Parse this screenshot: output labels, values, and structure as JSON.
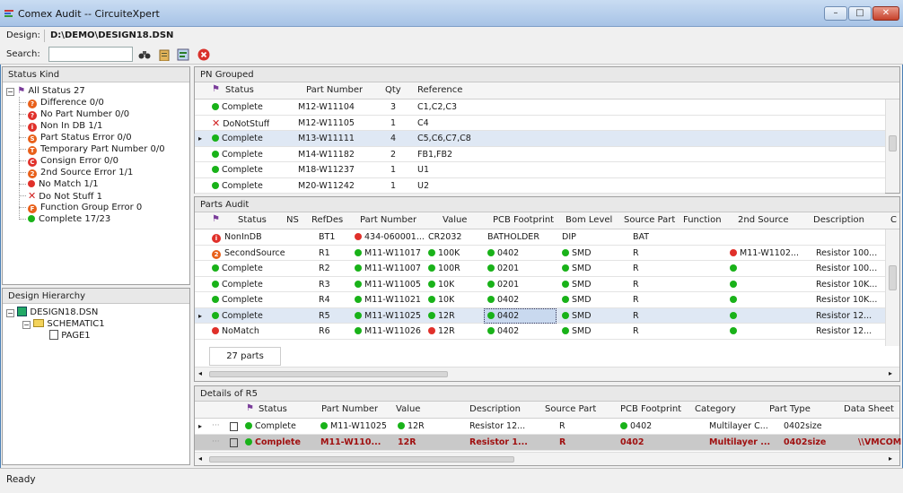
{
  "window": {
    "title": "Comex Audit -- CircuiteXpert",
    "min": "–",
    "max": "□",
    "close": "✕"
  },
  "design": {
    "label": "Design:",
    "path": "D:\\DEMO\\DESIGN18.DSN"
  },
  "search": {
    "label": "Search:",
    "value": ""
  },
  "status_kind": {
    "title": "Status Kind",
    "root": "All Status 27",
    "items": [
      {
        "label": "Difference 0/0",
        "icon": "o",
        "glyph": "?"
      },
      {
        "label": "No Part Number 0/0",
        "icon": "r",
        "glyph": "?"
      },
      {
        "label": "Non In DB 1/1",
        "icon": "r",
        "glyph": "i"
      },
      {
        "label": "Part Status Error 0/0",
        "icon": "o",
        "glyph": "S"
      },
      {
        "label": "Temporary Part Number 0/0",
        "icon": "o",
        "glyph": "T"
      },
      {
        "label": "Consign Error 0/0",
        "icon": "r",
        "glyph": "C"
      },
      {
        "label": "2nd Source Error 1/1",
        "icon": "o",
        "glyph": "2"
      },
      {
        "label": "No Match 1/1",
        "icon": "r",
        "glyph": ""
      },
      {
        "label": "Do Not Stuff 1",
        "icon": "x",
        "glyph": ""
      },
      {
        "label": "Function Group Error 0",
        "icon": "o",
        "glyph": "F"
      },
      {
        "label": "Complete 17/23",
        "icon": "g",
        "glyph": ""
      }
    ]
  },
  "hierarchy": {
    "title": "Design Hierarchy",
    "root": "DESIGN18.DSN",
    "schematic": "SCHEMATIC1",
    "page": "PAGE1"
  },
  "pn_grouped": {
    "title": "PN Grouped",
    "columns": [
      "Status",
      "Part Number",
      "Qty",
      "Reference"
    ],
    "rows": [
      {
        "status": "Complete",
        "pn": "M12-W11104",
        "qty": "3",
        "ref": "C1,C2,C3",
        "dot": "g"
      },
      {
        "status": "DoNotStuff",
        "pn": "M12-W11105",
        "qty": "1",
        "ref": "C4",
        "dot": "x"
      },
      {
        "status": "Complete",
        "pn": "M13-W11111",
        "qty": "4",
        "ref": "C5,C6,C7,C8",
        "dot": "g",
        "current": true
      },
      {
        "status": "Complete",
        "pn": "M14-W11182",
        "qty": "2",
        "ref": "FB1,FB2",
        "dot": "g"
      },
      {
        "status": "Complete",
        "pn": "M18-W11237",
        "qty": "1",
        "ref": "U1",
        "dot": "g"
      },
      {
        "status": "Complete",
        "pn": "M20-W11242",
        "qty": "1",
        "ref": "U2",
        "dot": "g"
      }
    ]
  },
  "parts_audit": {
    "title": "Parts Audit",
    "columns": [
      "Status",
      "NS",
      "RefDes",
      "Part Number",
      "Value",
      "PCB Footprint",
      "Bom Level",
      "Source Part",
      "Function",
      "2nd Source",
      "Description",
      "C"
    ],
    "rows": [
      {
        "status": "NonInDB",
        "ref": "BT1",
        "pn": "434-060001...",
        "val": "CR2032",
        "fp": "BATHOLDER",
        "bom": "DIP",
        "src": "BAT",
        "sec": "",
        "desc": "",
        "dot": "ri",
        "pndot": "r",
        "vdot": "",
        "fpdot": "",
        "bomdot": "",
        "secdot": ""
      },
      {
        "status": "SecondSource",
        "ref": "R1",
        "pn": "M11-W11017",
        "val": "100K",
        "fp": "0402",
        "bom": "SMD",
        "src": "R",
        "sec": "M11-W1102...",
        "desc": "Resistor 100...",
        "dot": "o2",
        "pndot": "g",
        "vdot": "g",
        "fpdot": "g",
        "bomdot": "g",
        "secdot": "r"
      },
      {
        "status": "Complete",
        "ref": "R2",
        "pn": "M11-W11007",
        "val": "100R",
        "fp": "0201",
        "bom": "SMD",
        "src": "R",
        "sec": "",
        "desc": "Resistor 100...",
        "dot": "g",
        "pndot": "g",
        "vdot": "g",
        "fpdot": "g",
        "bomdot": "g",
        "secdot": "g"
      },
      {
        "status": "Complete",
        "ref": "R3",
        "pn": "M11-W11005",
        "val": "10K",
        "fp": "0201",
        "bom": "SMD",
        "src": "R",
        "sec": "",
        "desc": "Resistor 10K...",
        "dot": "g",
        "pndot": "g",
        "vdot": "g",
        "fpdot": "g",
        "bomdot": "g",
        "secdot": "g"
      },
      {
        "status": "Complete",
        "ref": "R4",
        "pn": "M11-W11021",
        "val": "10K",
        "fp": "0402",
        "bom": "SMD",
        "src": "R",
        "sec": "",
        "desc": "Resistor 10K...",
        "dot": "g",
        "pndot": "g",
        "vdot": "g",
        "fpdot": "g",
        "bomdot": "g",
        "secdot": "g"
      },
      {
        "status": "Complete",
        "ref": "R5",
        "pn": "M11-W11025",
        "val": "12R",
        "fp": "0402",
        "bom": "SMD",
        "src": "R",
        "sec": "",
        "desc": "Resistor 12...",
        "dot": "g",
        "pndot": "g",
        "vdot": "g",
        "fpdot": "g",
        "bomdot": "g",
        "secdot": "g",
        "current": true
      },
      {
        "status": "NoMatch",
        "ref": "R6",
        "pn": "M11-W11026",
        "val": "12R",
        "fp": "0402",
        "bom": "SMD",
        "src": "R",
        "sec": "",
        "desc": "Resistor 12...",
        "dot": "r",
        "pndot": "g",
        "vdot": "r",
        "fpdot": "g",
        "bomdot": "g",
        "secdot": "g"
      }
    ],
    "count": "27 parts"
  },
  "details": {
    "title": "Details of R5",
    "columns": [
      "Status",
      "Part Number",
      "Value",
      "Description",
      "Source Part",
      "PCB Footprint",
      "Category",
      "Part Type",
      "Data Sheet"
    ],
    "rows": [
      {
        "status": "Complete",
        "pn": "M11-W11025",
        "val": "12R",
        "desc": "Resistor 12...",
        "src": "R",
        "fp": "0402",
        "cat": "Multilayer C...",
        "type": "0402size",
        "ds": ""
      },
      {
        "status": "Complete",
        "pn": "M11-W110...",
        "val": "12R",
        "desc": "Resistor 1...",
        "src": "R",
        "fp": "0402",
        "cat": "Multilayer ...",
        "type": "0402size",
        "ds": "\\\\VMCOM"
      }
    ]
  },
  "statusbar": {
    "text": "Ready"
  }
}
